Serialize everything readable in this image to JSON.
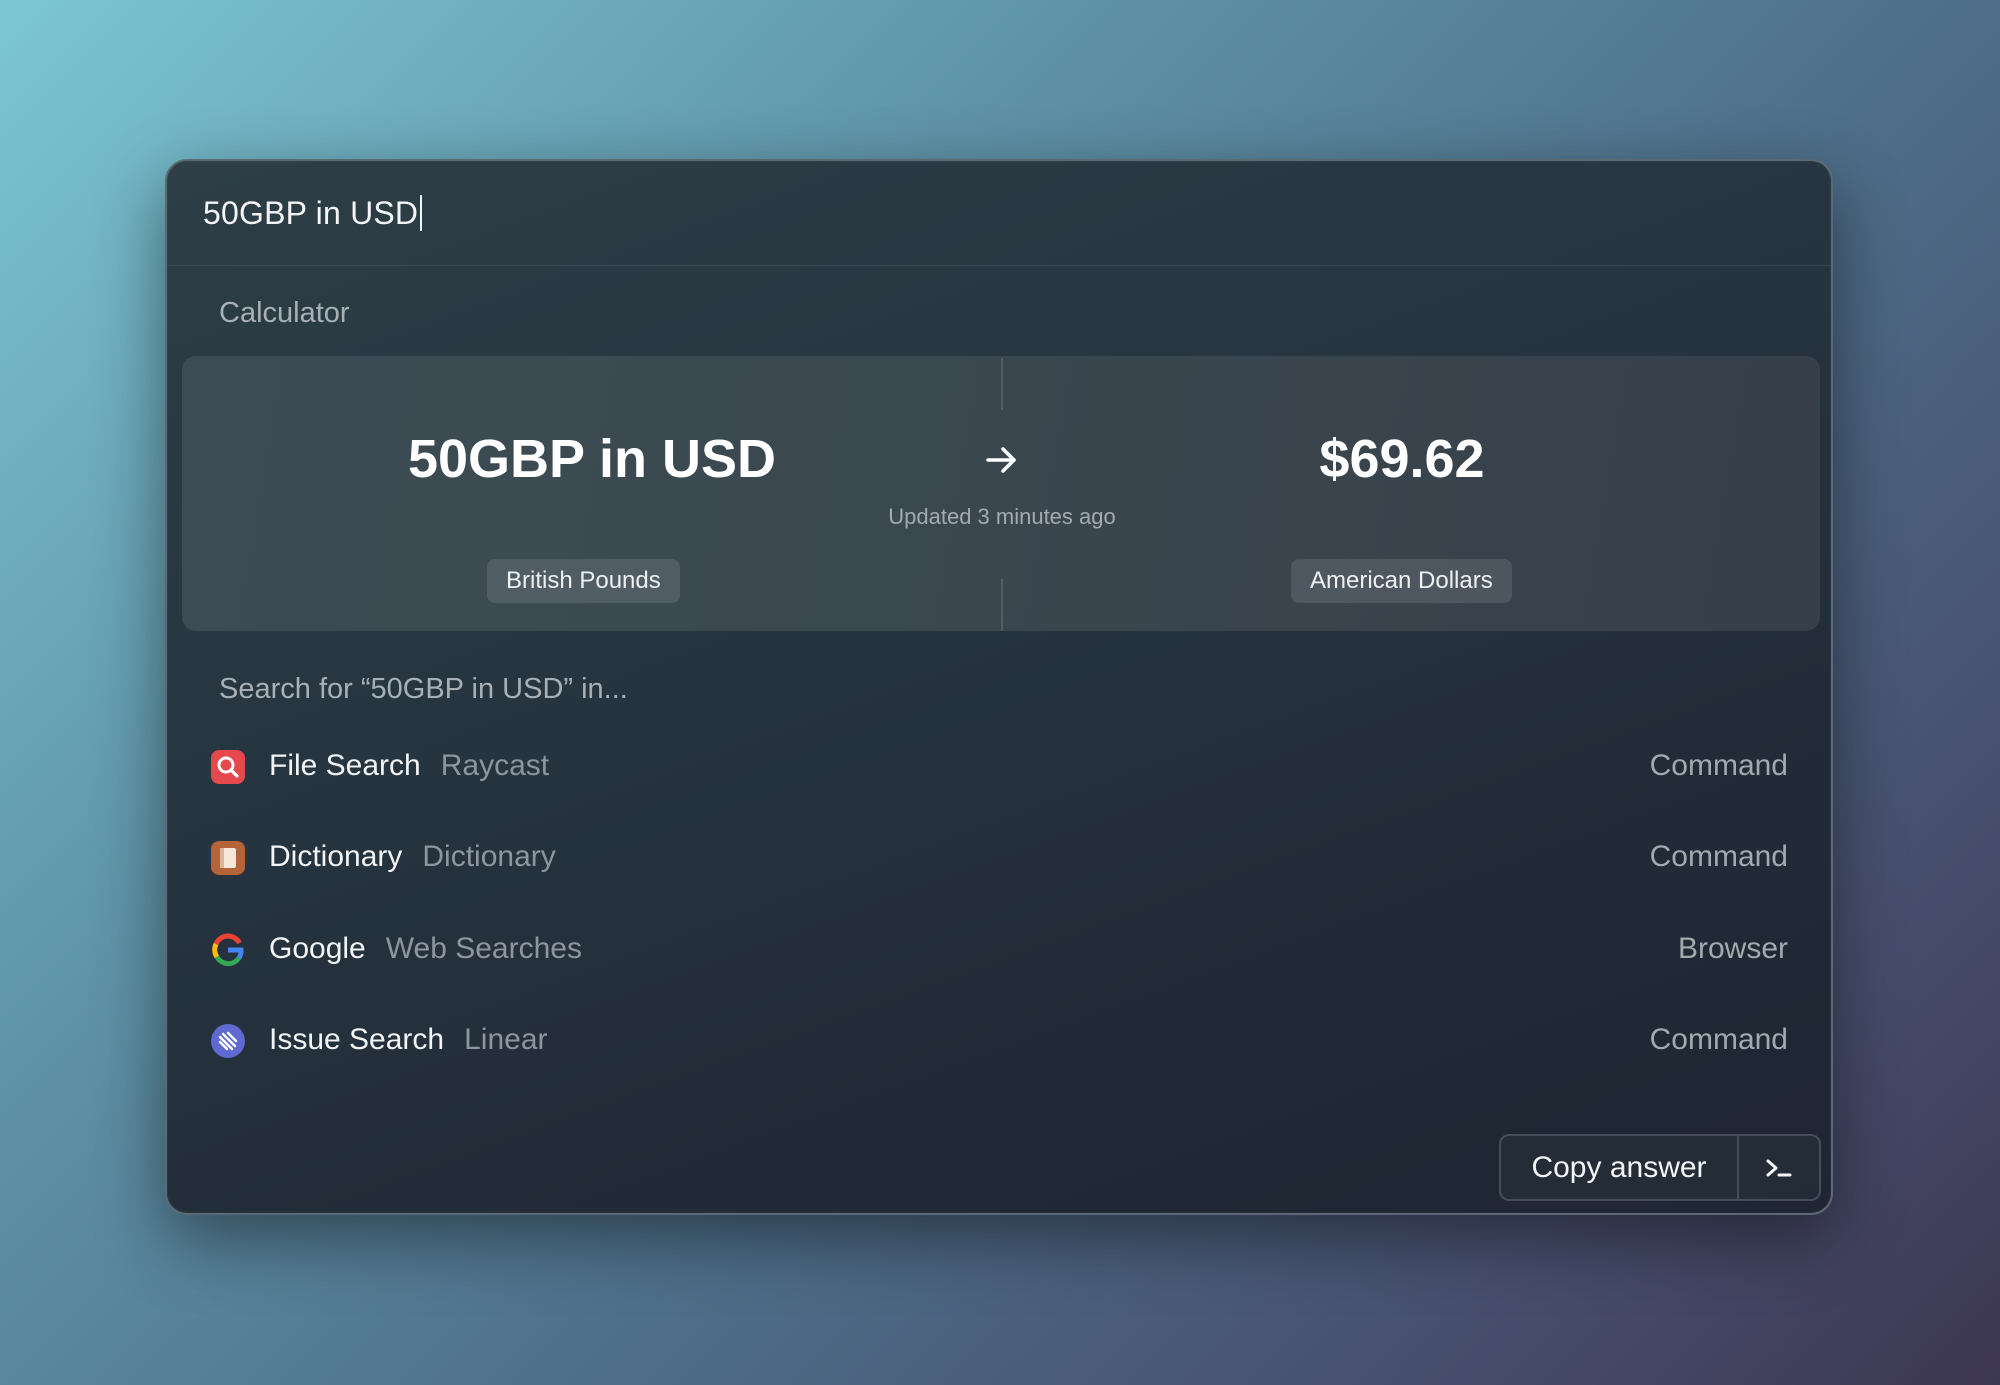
{
  "search": {
    "query": "50GBP in USD"
  },
  "calculator": {
    "section_title": "Calculator",
    "input_expression": "50GBP in USD",
    "result": "$69.62",
    "updated_text": "Updated 3 minutes ago",
    "from_unit": "British Pounds",
    "to_unit": "American Dollars"
  },
  "search_in": {
    "section_title": "Search for “50GBP in USD” in...",
    "items": [
      {
        "title": "File Search",
        "subtitle": "Raycast",
        "type": "Command",
        "icon": "file-search-icon",
        "icon_color": "#e5484d"
      },
      {
        "title": "Dictionary",
        "subtitle": "Dictionary",
        "type": "Command",
        "icon": "dictionary-icon",
        "icon_color": "#b5643a"
      },
      {
        "title": "Google",
        "subtitle": "Web Searches",
        "type": "Browser",
        "icon": "google-icon",
        "icon_color": "#4285f4"
      },
      {
        "title": "Issue Search",
        "subtitle": "Linear",
        "type": "Command",
        "icon": "linear-icon",
        "icon_color": "#5e6ad2"
      }
    ]
  },
  "actions": {
    "primary_label": "Copy answer",
    "secondary_icon": "terminal-icon"
  }
}
